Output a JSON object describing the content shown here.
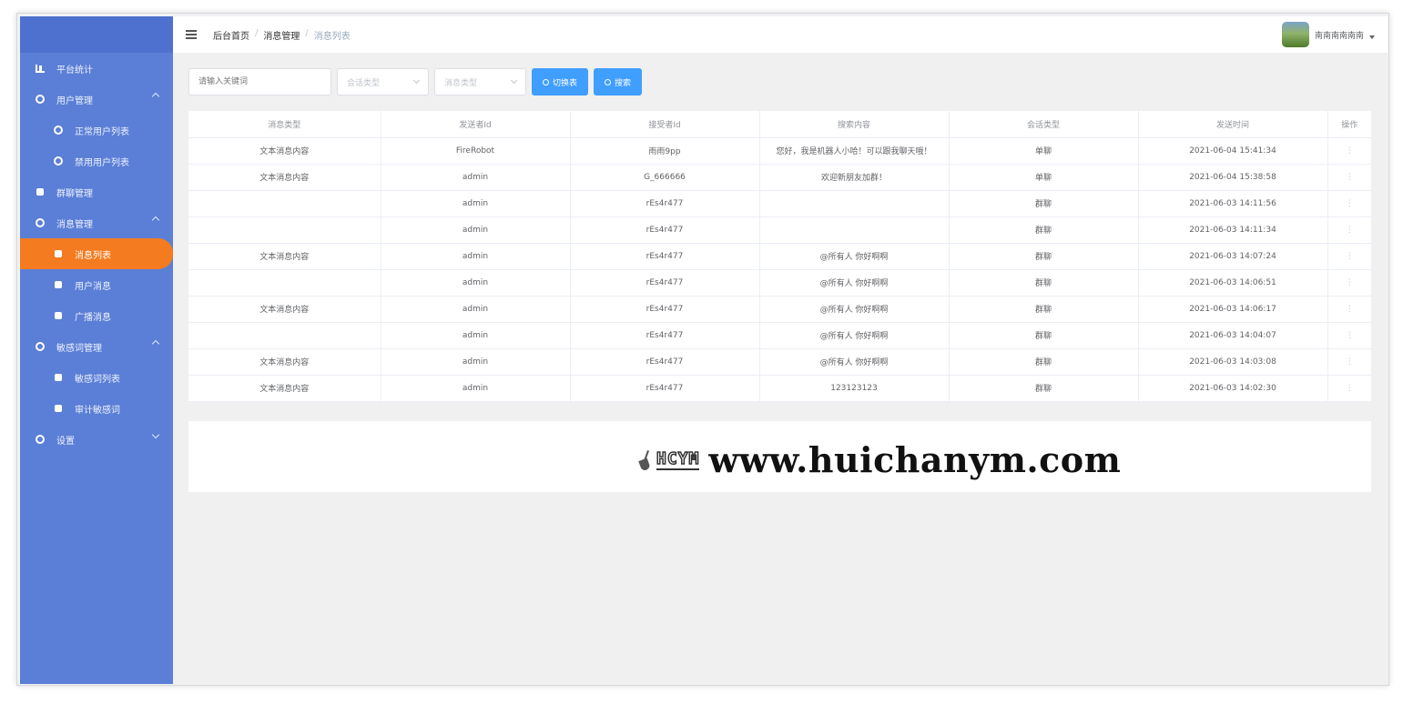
{
  "sidebar": {
    "items": [
      {
        "label": "平台统计",
        "icon": "bar-chart-icon",
        "level": 1
      },
      {
        "label": "用户管理",
        "icon": "circle-icon",
        "level": 1,
        "expanded": true
      },
      {
        "label": "正常用户列表",
        "icon": "circle-icon",
        "level": 2
      },
      {
        "label": "禁用用户列表",
        "icon": "circle-icon",
        "level": 2
      },
      {
        "label": "群聊管理",
        "icon": "chat-icon",
        "level": 1
      },
      {
        "label": "消息管理",
        "icon": "circle-icon",
        "level": 1,
        "expanded": true
      },
      {
        "label": "消息列表",
        "icon": "message-icon",
        "level": 2,
        "active": true
      },
      {
        "label": "用户消息",
        "icon": "message-icon",
        "level": 2
      },
      {
        "label": "广播消息",
        "icon": "message-icon",
        "level": 2
      },
      {
        "label": "敏感词管理",
        "icon": "circle-icon",
        "level": 1,
        "expanded": true
      },
      {
        "label": "敏感词列表",
        "icon": "message-icon",
        "level": 2
      },
      {
        "label": "审计敏感词",
        "icon": "message-icon",
        "level": 2
      },
      {
        "label": "设置",
        "icon": "circle-icon",
        "level": 1,
        "expanded": false
      }
    ]
  },
  "header": {
    "breadcrumb": [
      "后台首页",
      "消息管理",
      "消息列表"
    ],
    "username": "南南南南南南"
  },
  "filters": {
    "keyword_placeholder": "请输入关键词",
    "session_type_placeholder": "会话类型",
    "message_type_placeholder": "消息类型",
    "switch_button": "切换表",
    "search_button": "搜索"
  },
  "table": {
    "columns": [
      "消息类型",
      "发送者Id",
      "接受者Id",
      "搜索内容",
      "会话类型",
      "发送时间",
      "操作"
    ],
    "rows": [
      [
        "文本消息内容",
        "FireRobot",
        "雨雨9pp",
        "您好，我是机器人小哈！可以跟我聊天哦！",
        "单聊",
        "2021-06-04 15:41:34",
        "⋮"
      ],
      [
        "文本消息内容",
        "admin",
        "G_666666",
        "欢迎新朋友加群！",
        "单聊",
        "2021-06-04 15:38:58",
        "⋮"
      ],
      [
        "",
        "admin",
        "rEs4r477",
        "",
        "群聊",
        "2021-06-03 14:11:56",
        "⋮"
      ],
      [
        "",
        "admin",
        "rEs4r477",
        "",
        "群聊",
        "2021-06-03 14:11:34",
        "⋮"
      ],
      [
        "文本消息内容",
        "admin",
        "rEs4r477",
        "@所有人 你好啊啊",
        "群聊",
        "2021-06-03 14:07:24",
        "⋮"
      ],
      [
        "",
        "admin",
        "rEs4r477",
        "@所有人 你好啊啊",
        "群聊",
        "2021-06-03 14:06:51",
        "⋮"
      ],
      [
        "文本消息内容",
        "admin",
        "rEs4r477",
        "@所有人 你好啊啊",
        "群聊",
        "2021-06-03 14:06:17",
        "⋮"
      ],
      [
        "",
        "admin",
        "rEs4r477",
        "@所有人 你好啊啊",
        "群聊",
        "2021-06-03 14:04:07",
        "⋮"
      ],
      [
        "文本消息内容",
        "admin",
        "rEs4r477",
        "@所有人 你好啊啊",
        "群聊",
        "2021-06-03 14:03:08",
        "⋮"
      ],
      [
        "文本消息内容",
        "admin",
        "rEs4r477",
        "123123123",
        "群聊",
        "2021-06-03 14:02:30",
        "⋮"
      ]
    ]
  },
  "watermark": {
    "logo_text": "HCYM",
    "url": "www.huichanym.com"
  }
}
